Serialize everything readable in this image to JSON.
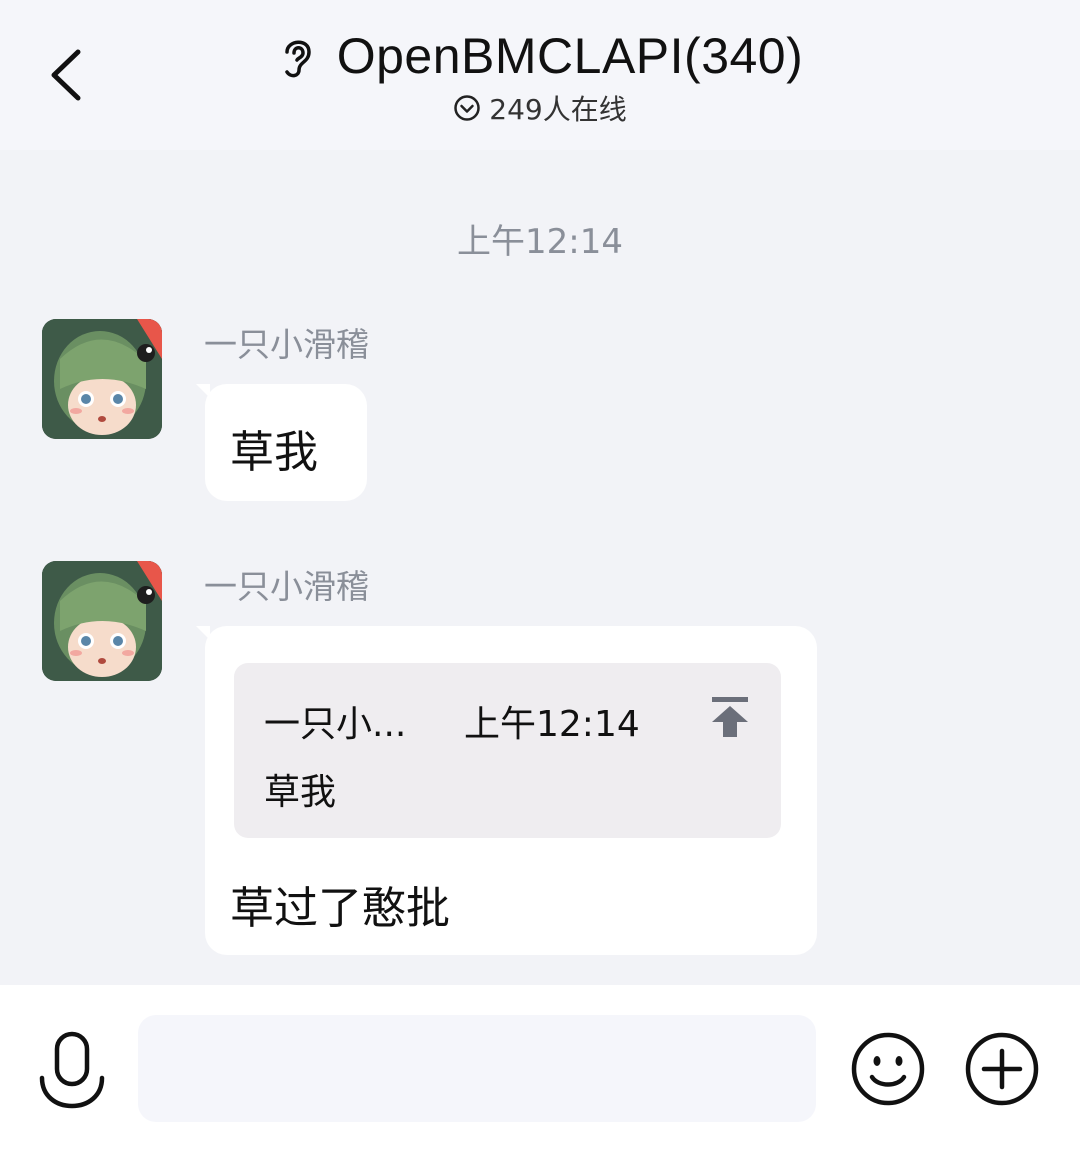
{
  "header": {
    "title": "OpenBMCLAPI(340)",
    "online": "249人在线",
    "icons": {
      "back": "chevron-left-icon",
      "ear": "ear-icon",
      "online": "chevron-down-circle-icon"
    }
  },
  "chat": {
    "time_label": "上午12:14",
    "messages": [
      {
        "sender": "一只小滑稽",
        "text": "草我"
      },
      {
        "sender": "一只小滑稽",
        "quote": {
          "sender": "一只小...",
          "time": "上午12:14",
          "text": "草我"
        },
        "text": "草过了憨批"
      }
    ]
  },
  "input_bar": {
    "placeholder": "",
    "icons": {
      "voice": "microphone-icon",
      "emoji": "smiley-icon",
      "more": "plus-circle-icon"
    }
  },
  "colors": {
    "header_bg": "#f5f6fa",
    "chat_bg": "#f2f3f7",
    "quote_bg": "#efedf0",
    "meta_text": "#8a8f99"
  }
}
